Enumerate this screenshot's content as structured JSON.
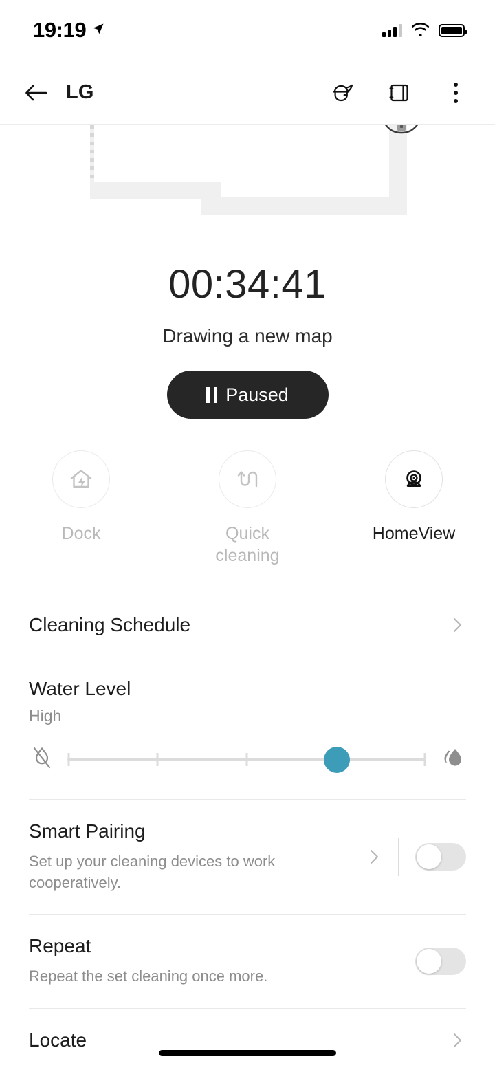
{
  "status_bar": {
    "time": "19:19",
    "location_icon": "location-arrow-icon",
    "signal_icon": "cellular-signal-icon",
    "signal_bars_filled": 3,
    "signal_bars_total": 4,
    "wifi_icon": "wifi-icon",
    "battery_icon": "battery-full-icon"
  },
  "app_bar": {
    "back_icon": "back-arrow-icon",
    "title": "LG",
    "robot_icon": "robot-vacuum-icon",
    "panel_icon": "map-panel-icon",
    "menu_icon": "overflow-menu-icon"
  },
  "map": {
    "robot_marker_icon": "robot-marker-icon",
    "wall_color": "#f0f0f0",
    "dotted_edge_color": "#d7d7d7"
  },
  "cleaning": {
    "timer": "00:34:41",
    "status": "Drawing a new map",
    "pause_button_label": "Paused",
    "pause_icon": "pause-icon",
    "pause_button_color": "#262626"
  },
  "actions": [
    {
      "label": "Dock",
      "icon": "dock-home-charge-icon",
      "enabled": false
    },
    {
      "label": "Quick\ncleaning",
      "label_line1": "Quick",
      "label_line2": "cleaning",
      "icon": "quick-cleaning-path-icon",
      "enabled": false
    },
    {
      "label": "HomeView",
      "icon": "camera-homeview-icon",
      "enabled": true
    }
  ],
  "list": {
    "cleaning_schedule": {
      "title": "Cleaning Schedule",
      "chevron_icon": "chevron-right-icon"
    },
    "water_level": {
      "title": "Water Level",
      "value": "High",
      "min_icon": "water-off-icon",
      "max_icon": "water-droplets-icon",
      "steps": 5,
      "current_index": 3,
      "thumb_color": "#3d9cb8",
      "track_color": "#dcdcdc"
    },
    "smart_pairing": {
      "title": "Smart Pairing",
      "subtitle": "Set up your cleaning devices to work cooperatively.",
      "chevron_icon": "chevron-right-icon",
      "toggle_on": false
    },
    "repeat": {
      "title": "Repeat",
      "subtitle": "Repeat the set cleaning once more.",
      "toggle_on": false
    },
    "locate": {
      "title": "Locate",
      "chevron_icon": "chevron-right-icon"
    }
  },
  "home_indicator": "home-indicator"
}
